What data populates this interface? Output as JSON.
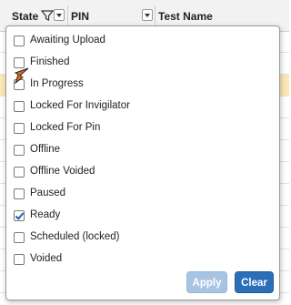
{
  "header": {
    "state_label": "State",
    "pin_label": "PIN",
    "test_name_label": "Test Name"
  },
  "filter_popup": {
    "options": [
      {
        "label": "Awaiting Upload",
        "checked": false
      },
      {
        "label": "Finished",
        "checked": false
      },
      {
        "label": "In Progress",
        "checked": false
      },
      {
        "label": "Locked For Invigilator",
        "checked": false
      },
      {
        "label": "Locked For Pin",
        "checked": false
      },
      {
        "label": "Offline",
        "checked": false
      },
      {
        "label": "Offline Voided",
        "checked": false
      },
      {
        "label": "Paused",
        "checked": false
      },
      {
        "label": "Ready",
        "checked": true
      },
      {
        "label": "Scheduled (locked)",
        "checked": false
      },
      {
        "label": "Voided",
        "checked": false
      }
    ],
    "apply_label": "Apply",
    "clear_label": "Clear",
    "apply_enabled": false
  },
  "colors": {
    "header_bg": "#f2f2f2",
    "highlight_row": "#fde7b4",
    "clear_button": "#2a6fb8",
    "apply_button_disabled": "#a8c4e3",
    "checkmark": "#1e5fb3",
    "cursor_arrow": "#e8661a"
  }
}
